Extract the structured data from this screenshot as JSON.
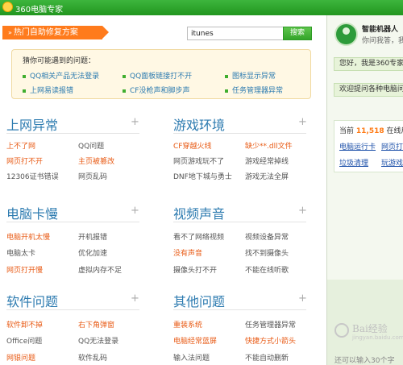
{
  "window": {
    "title": "360电脑专家"
  },
  "main": {
    "hotfix_label": "热门自助修复方案",
    "search": {
      "value": "itunes",
      "button": "搜索"
    },
    "guess": {
      "heading": "猜你可能遇到的问题：",
      "items": [
        "QQ相关产品无法登录",
        "QQ面板链接打不开",
        "图标显示异常",
        "上网易读报错",
        "CF没枪声和脚步声",
        "任务管理器异常"
      ]
    },
    "sections": [
      {
        "title": "上网异常",
        "links": [
          "上不了网",
          "QQ问题",
          "网页打不开",
          "主页被篡改",
          "12306证书错误",
          "网页乱码"
        ]
      },
      {
        "title": "游戏环境",
        "links": [
          "CF穿越火线",
          "缺少**.dll文件",
          "网页游戏玩不了",
          "游戏经常掉线",
          "DNF地下城与勇士",
          "游戏无法全屏"
        ]
      },
      {
        "title": "电脑卡慢",
        "links": [
          "电脑开机太慢",
          "开机报错",
          "电脑太卡",
          "优化加速",
          "网页打开慢",
          "虚拟内存不足"
        ]
      },
      {
        "title": "视频声音",
        "links": [
          "看不了网络视频",
          "视频设备异常",
          "没有声音",
          "找不到摄像头",
          "摄像头打不开",
          "不能在线听歌"
        ]
      },
      {
        "title": "软件问题",
        "links": [
          "软件卸不掉",
          "右下角弹窗",
          "Office问题",
          "QQ无法登录",
          "网银问题",
          "软件乱码"
        ]
      },
      {
        "title": "其他问题",
        "links": [
          "重装系统",
          "任务管理器异常",
          "电脑经常蓝屏",
          "快捷方式小箭头",
          "输入法问题",
          "不能自动删新"
        ]
      }
    ]
  },
  "side": {
    "robot_name": "智能机器人",
    "robot_sub": "你问我答，我",
    "messages": [
      "您好，我是360专家",
      "欢迎提问各种电脑问题"
    ],
    "online_prefix": "当前",
    "online_count": "11,518",
    "online_suffix": "在线用户",
    "quick_links": [
      "电脑运行卡",
      "网页打不开",
      "垃圾清理",
      "玩游戏卡"
    ],
    "input_hint": "还可以输入30个字"
  },
  "watermark": {
    "text": "Bai经验",
    "url": "jingyan.baidu.com"
  },
  "colors": {
    "green": "#2fa52a",
    "orange": "#ff7b1c",
    "blue": "#2d7bb0",
    "hot_link": "#e85a14"
  }
}
